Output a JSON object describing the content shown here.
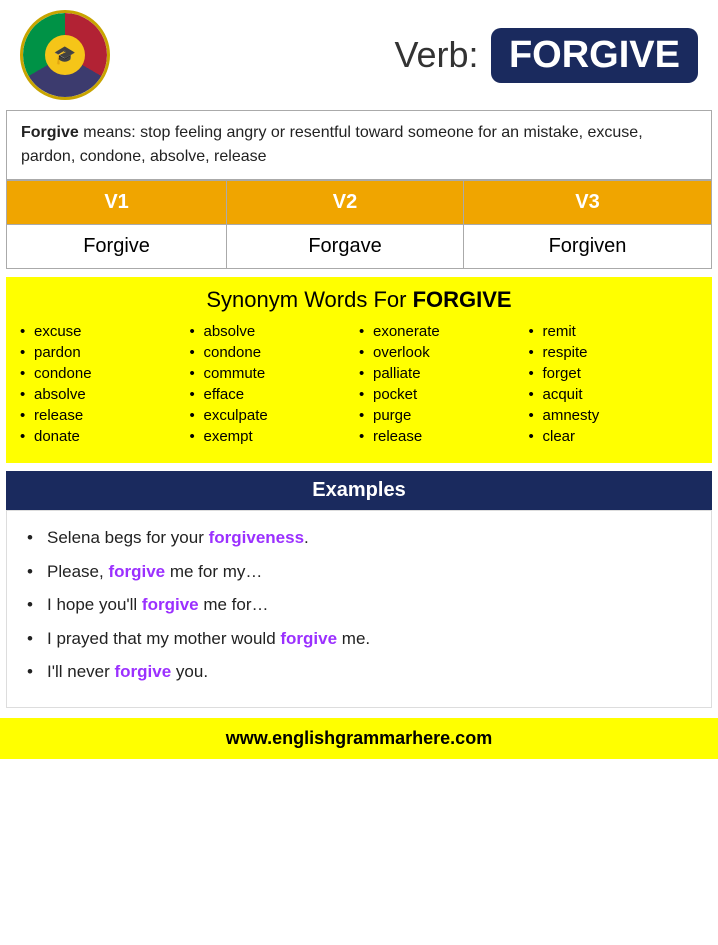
{
  "header": {
    "verb_label": "Verb:",
    "verb_word": "FORGIVE",
    "logo_alt": "English Grammar Here"
  },
  "definition": {
    "bold_word": "Forgive",
    "text": " means: stop feeling angry or resentful toward someone for an mistake, excuse, pardon, condone, absolve, release"
  },
  "verb_table": {
    "headers": [
      "V1",
      "V2",
      "V3"
    ],
    "row": [
      "Forgive",
      "Forgave",
      "Forgiven"
    ]
  },
  "synonym_section": {
    "title_plain": "Synonym Words For ",
    "title_bold": "FORGIVE",
    "columns": [
      [
        "excuse",
        "pardon",
        "condone",
        "absolve",
        "release",
        "donate"
      ],
      [
        "absolve",
        "condone",
        "commute",
        "efface",
        "exculpate",
        "exempt"
      ],
      [
        "exonerate",
        "overlook",
        "palliate",
        "pocket",
        "purge",
        "release"
      ],
      [
        "remit",
        "respite",
        "forget",
        "acquit",
        "amnesty",
        "clear"
      ]
    ]
  },
  "examples_section": {
    "header": "Examples",
    "items": [
      {
        "text": "Selena begs for your ",
        "highlight": "forgiveness",
        "rest": "."
      },
      {
        "text": "Please, ",
        "highlight": "forgive",
        "rest": " me for my…"
      },
      {
        "text": "I hope you'll ",
        "highlight": "forgive",
        "rest": " me for…"
      },
      {
        "text": "I prayed that my mother would ",
        "highlight": "forgive",
        "rest": " me."
      },
      {
        "text": "I'll never ",
        "highlight": "forgive",
        "rest": " you."
      }
    ]
  },
  "footer": {
    "url": "www.englishgrammarhere.com"
  }
}
